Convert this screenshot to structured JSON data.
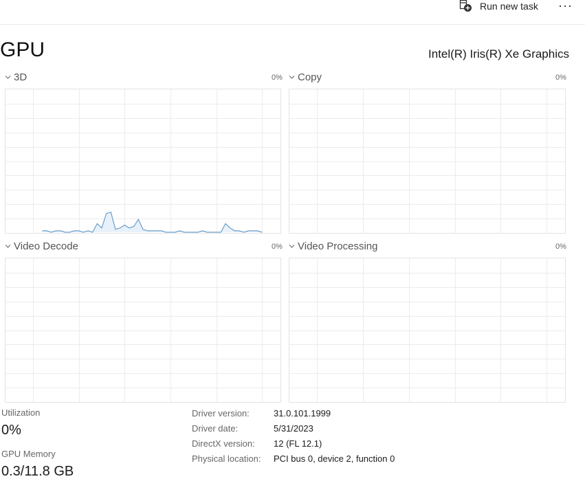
{
  "toolbar": {
    "run_new_task_label": "Run new task",
    "more_label": "···"
  },
  "header": {
    "title": "GPU",
    "adapter_name": "Intel(R) Iris(R) Xe Graphics"
  },
  "panels": [
    {
      "label": "3D",
      "percent": "0%"
    },
    {
      "label": "Copy",
      "percent": "0%"
    },
    {
      "label": "Video Decode",
      "percent": "0%"
    },
    {
      "label": "Video Processing",
      "percent": "0%"
    }
  ],
  "colors": {
    "grid_line": "#ececec",
    "graph_border": "#e3e3e3",
    "series_line": "#6a9ec9",
    "series_fill": "#e8f1fa"
  },
  "chart_data": {
    "type": "area",
    "x": [
      0,
      1,
      2,
      3,
      4,
      5,
      6,
      7,
      8,
      9,
      10,
      11,
      12,
      13,
      14,
      15,
      16,
      17,
      18,
      19,
      20,
      21,
      22,
      23,
      24,
      25,
      26,
      27,
      28,
      29,
      30,
      31,
      32,
      33,
      34,
      35,
      36,
      37,
      38,
      39,
      40,
      41,
      42,
      43,
      44,
      45,
      46,
      47,
      48,
      49,
      50,
      51,
      52,
      53,
      54,
      55,
      56,
      57,
      58,
      59,
      60
    ],
    "series": [
      {
        "values": [
          0,
          0,
          0,
          0,
          0,
          0,
          0,
          0,
          1,
          1,
          0,
          1,
          1,
          0,
          0,
          1,
          1,
          0,
          1,
          0,
          6,
          3,
          13,
          14,
          2,
          3,
          5,
          3,
          4,
          9,
          2,
          1,
          1,
          1,
          1,
          0,
          0,
          0,
          1,
          0,
          0,
          0,
          0,
          1,
          0,
          0,
          0,
          0,
          6,
          3,
          1,
          1,
          0,
          1,
          1,
          1,
          0,
          0,
          0,
          0,
          0
        ]
      }
    ],
    "ylim": [
      0,
      100
    ]
  },
  "stats": {
    "utilization_label": "Utilization",
    "utilization_value": "0%",
    "memory_label": "GPU Memory",
    "memory_value": "0.3/11.8 GB"
  },
  "details": {
    "driver_version_label": "Driver version:",
    "driver_version_value": "31.0.101.1999",
    "driver_date_label": "Driver date:",
    "driver_date_value": "5/31/2023",
    "directx_label": "DirectX version:",
    "directx_value": "12 (FL 12.1)",
    "location_label": "Physical location:",
    "location_value": "PCI bus 0, device 2, function 0"
  }
}
